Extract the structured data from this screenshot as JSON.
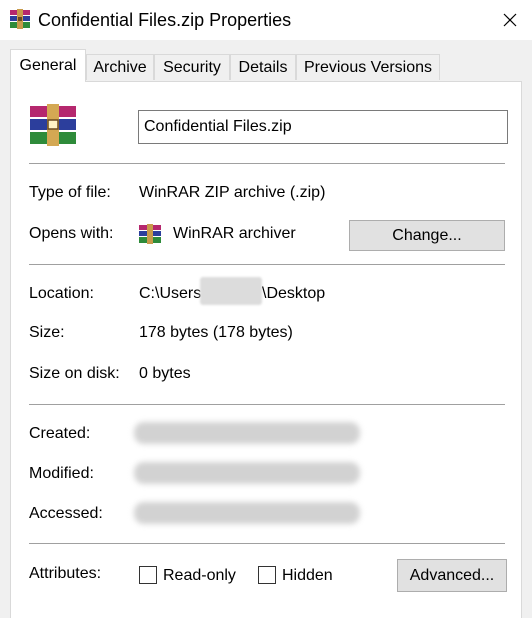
{
  "window": {
    "title": "Confidential Files.zip Properties",
    "close_icon": "close-icon",
    "app_icon": "winrar-icon"
  },
  "tabs": [
    {
      "label": "General",
      "active": true
    },
    {
      "label": "Archive",
      "active": false
    },
    {
      "label": "Security",
      "active": false
    },
    {
      "label": "Details",
      "active": false
    },
    {
      "label": "Previous Versions",
      "active": false
    }
  ],
  "general": {
    "file_name": "Confidential Files.zip",
    "type_label": "Type of file:",
    "type_value": "WinRAR ZIP archive (.zip)",
    "opens_label": "Opens with:",
    "opens_value": "WinRAR archiver",
    "change_button": "Change...",
    "location_label": "Location:",
    "location_prefix": "C:\\Users",
    "location_suffix": "\\Desktop",
    "size_label": "Size:",
    "size_value": "178 bytes (178 bytes)",
    "size_on_disk_label": "Size on disk:",
    "size_on_disk_value": "0 bytes",
    "created_label": "Created:",
    "modified_label": "Modified:",
    "accessed_label": "Accessed:",
    "attributes_label": "Attributes:",
    "readonly_label": "Read-only",
    "readonly_checked": false,
    "hidden_label": "Hidden",
    "hidden_checked": false,
    "advanced_button": "Advanced..."
  }
}
